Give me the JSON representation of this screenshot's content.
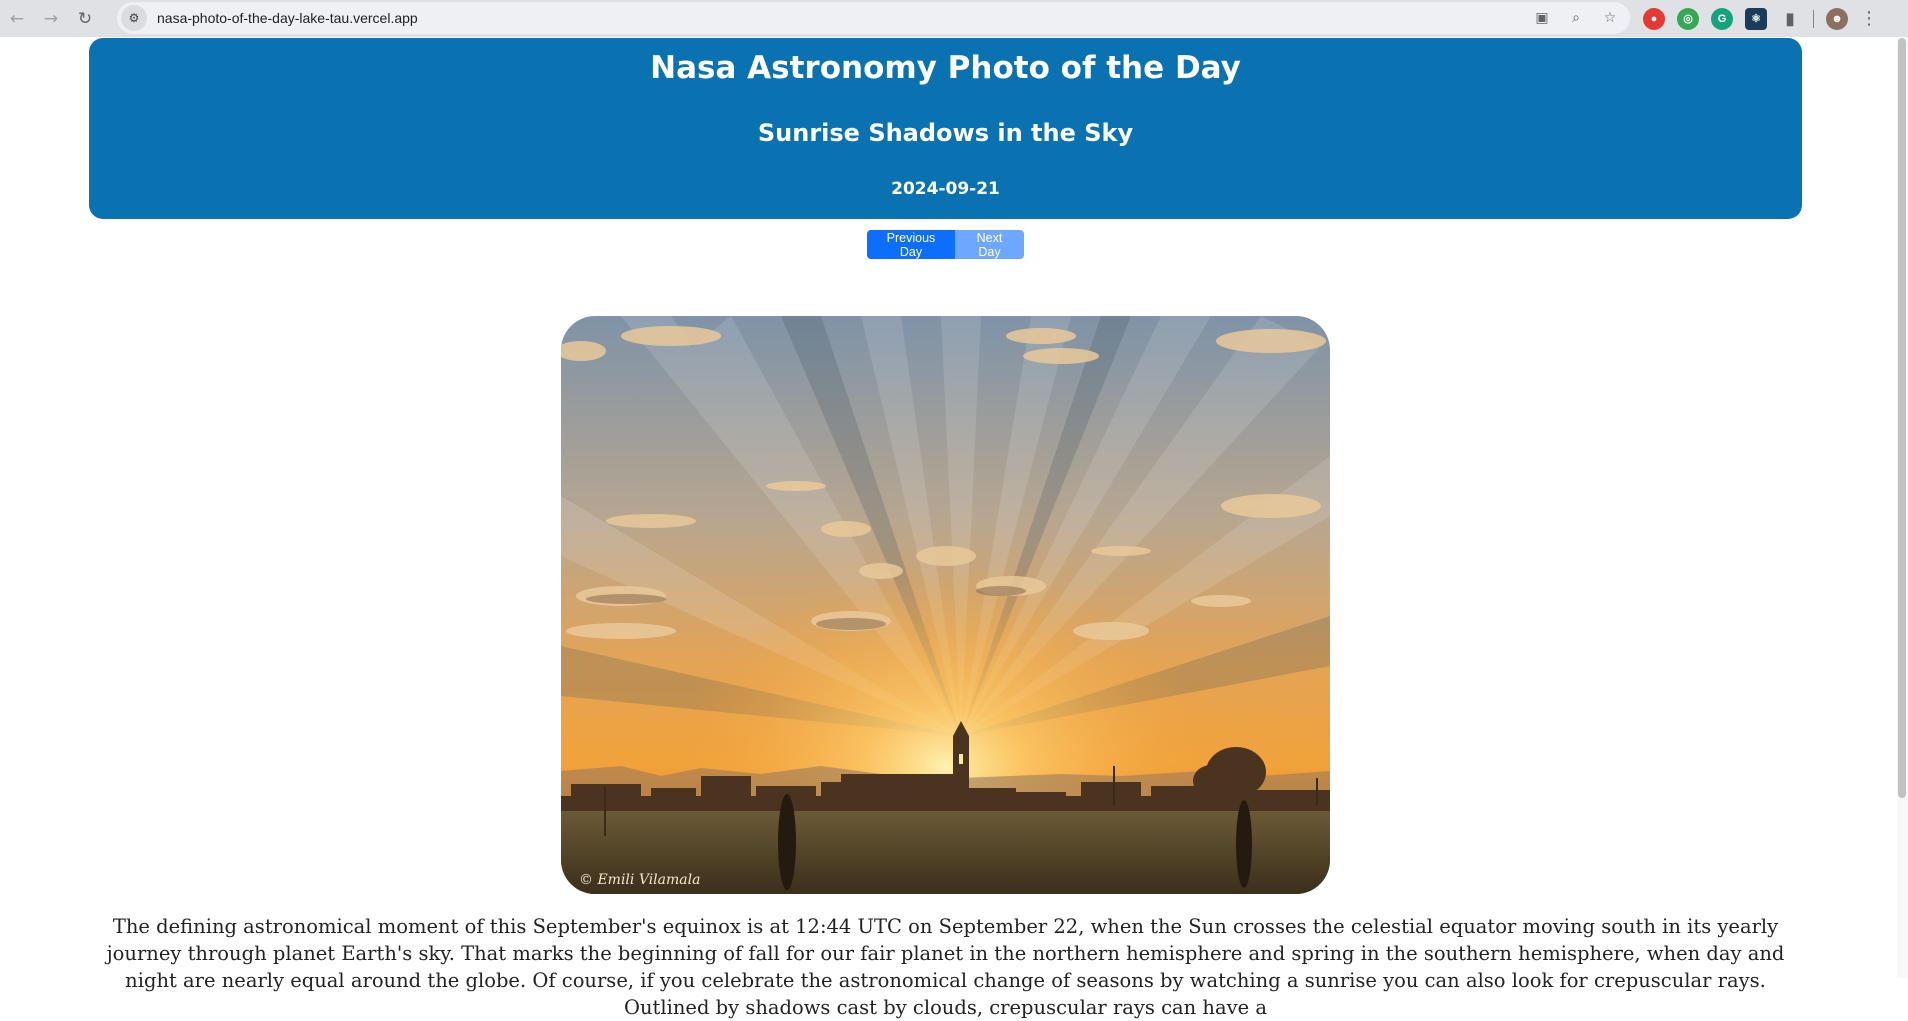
{
  "browser": {
    "url": "nasa-photo-of-the-day-lake-tau.vercel.app",
    "icons": [
      "back-icon",
      "forward-icon",
      "reload-icon",
      "site-info-icon",
      "install-icon",
      "zoom-icon",
      "bookmark-star-icon",
      "extensions-icon",
      "profile-avatar",
      "menu-icon"
    ]
  },
  "header": {
    "title": "Nasa Astronomy Photo of the Day",
    "subtitle": "Sunrise Shadows in the Sky",
    "date": "2024-09-21"
  },
  "nav": {
    "prev_label": "Previous Day",
    "next_label": "Next Day"
  },
  "photo": {
    "alt": "Sunrise Shadows in the Sky",
    "credit": "© Emili Vilamala"
  },
  "explanation": "The defining astronomical moment of this September's equinox is at 12:44 UTC on September 22, when the Sun crosses the celestial equator moving south in its yearly journey through planet Earth's sky. That marks the beginning of fall for our fair planet in the northern hemisphere and spring in the southern hemisphere, when day and night are nearly equal around the globe. Of course, if you celebrate the astronomical change of seasons by watching a sunrise you can also look for crepuscular rays. Outlined by shadows cast by clouds, crepuscular rays can have a",
  "colors": {
    "header_bg": "#0a72b0",
    "prev_button": "#0d6efd",
    "next_button": "#6ea8fe"
  }
}
